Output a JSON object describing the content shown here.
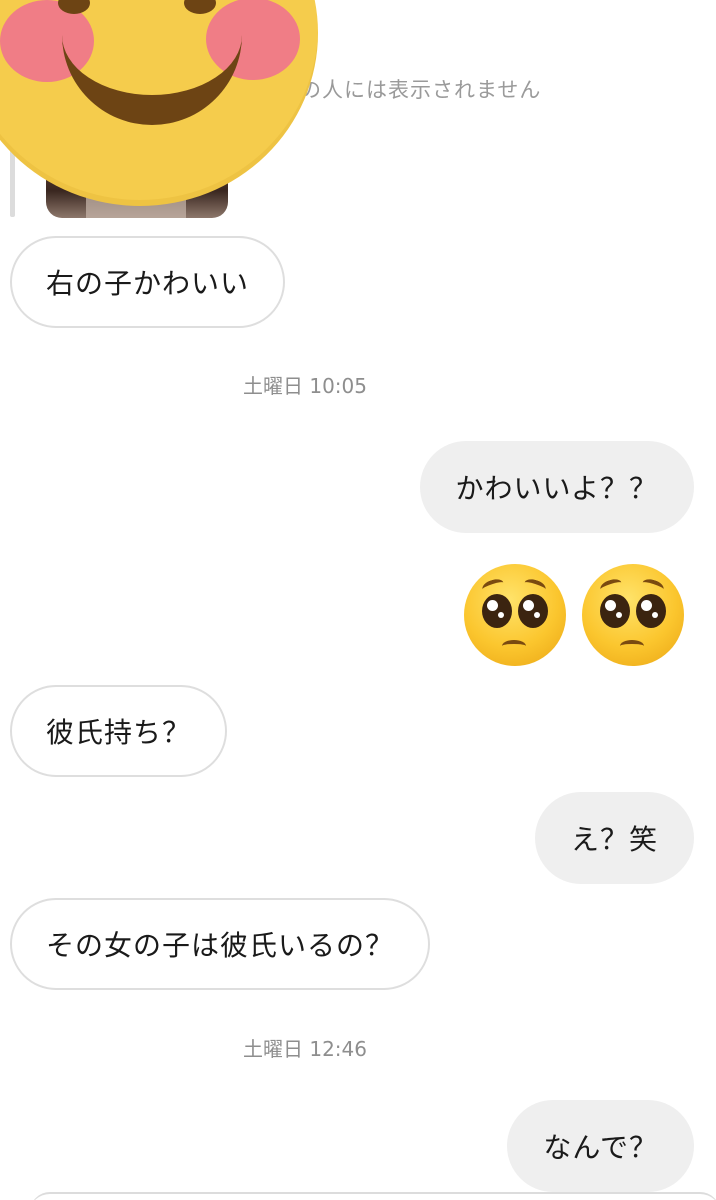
{
  "header": {
    "hidden_notice": "の人には表示されません"
  },
  "messages": [
    {
      "id": "m1",
      "direction": "in",
      "text": "右の子かわいい"
    },
    {
      "id": "m2",
      "direction": "out",
      "text": "かわいいよ？？"
    },
    {
      "id": "m3",
      "direction": "out",
      "emoji": "pleading-face ×2"
    },
    {
      "id": "m4",
      "direction": "in",
      "text": "彼氏持ち？"
    },
    {
      "id": "m5",
      "direction": "out",
      "text": "え？笑"
    },
    {
      "id": "m6",
      "direction": "in",
      "text": "その女の子は彼氏いるの？"
    },
    {
      "id": "m7",
      "direction": "out",
      "text": "なんで？"
    }
  ],
  "timestamps": [
    {
      "id": "t1",
      "text": "土曜日 10:05"
    },
    {
      "id": "t2",
      "text": "土曜日 12:46"
    }
  ],
  "colors": {
    "incoming_border": "#dedede",
    "outgoing_background": "#efefef",
    "timestamp_text": "#8e8e8e",
    "sticker_yellow": "#f5cc4c",
    "sticker_cheek": "#f07d86"
  }
}
